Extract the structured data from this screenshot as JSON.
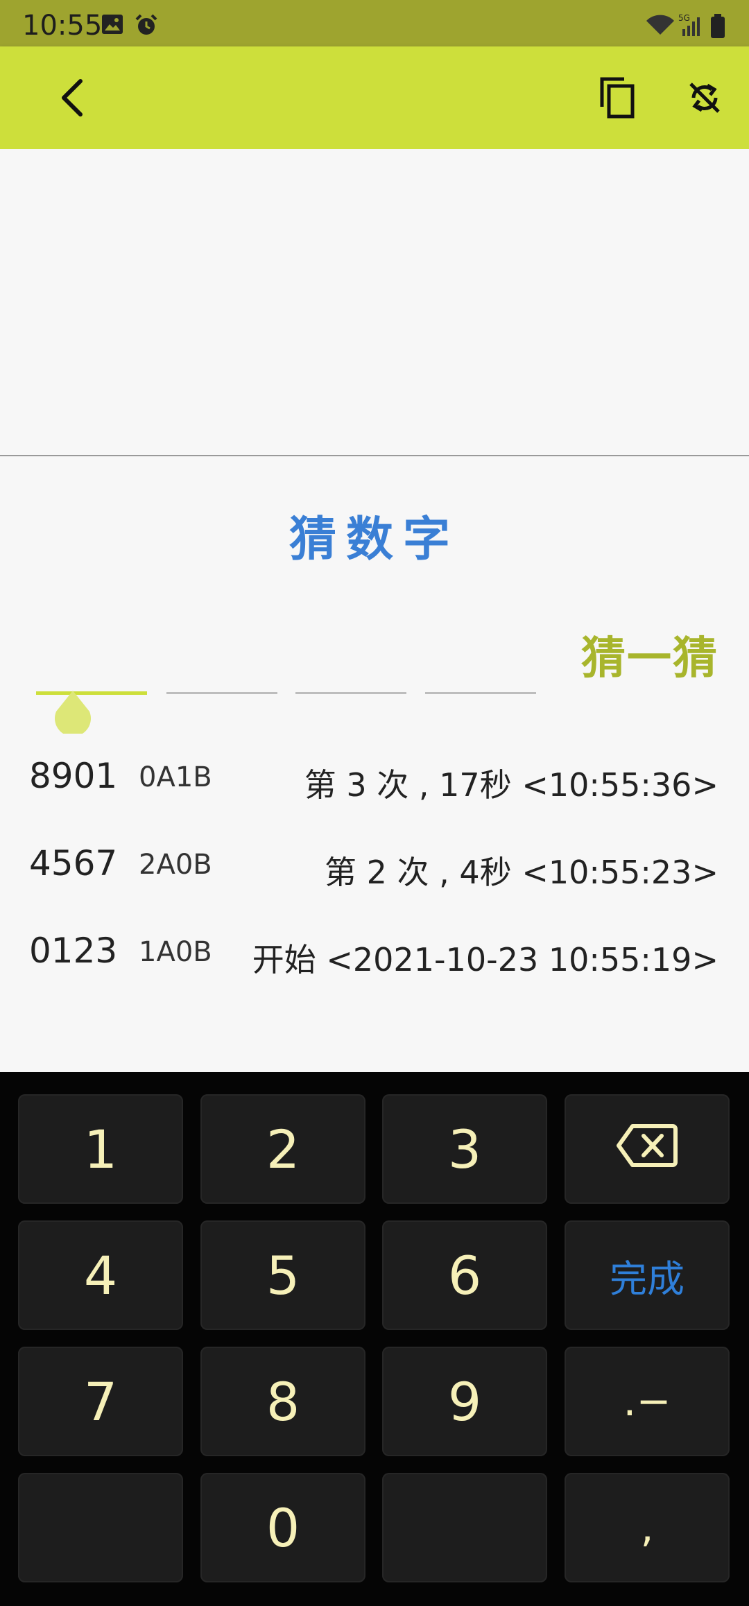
{
  "status_bar": {
    "time": "10:55"
  },
  "app_bar": {
    "icons": [
      "back-arrow-icon",
      "copy-icon",
      "sync-disabled-icon"
    ]
  },
  "title": "猜数字",
  "guess_button": "猜一猜",
  "history": [
    {
      "number": "8901",
      "result": "0A1B",
      "info": "第 3 次 , 17秒 <10:55:36>"
    },
    {
      "number": "4567",
      "result": "2A0B",
      "info": "第 2 次 , 4秒 <10:55:23>"
    },
    {
      "number": "0123",
      "result": "1A0B",
      "info": "开始 <2021-10-23 10:55:19>"
    }
  ],
  "keyboard": {
    "row1": [
      "1",
      "2",
      "3"
    ],
    "row2": [
      "4",
      "5",
      "6"
    ],
    "row3": [
      "7",
      "8",
      "9"
    ],
    "row4": [
      "",
      "0",
      ""
    ],
    "backspace_icon": "backspace-icon",
    "done": "完成",
    "dot_minus": ".−",
    "comma": ","
  },
  "colors": {
    "status_bar": "#9ea42f",
    "app_bar": "#cddf3b",
    "title": "#3a7fd5",
    "guess_button": "#a8b52c",
    "key_text": "#f6f0b8",
    "done_text": "#2f7fd9"
  }
}
